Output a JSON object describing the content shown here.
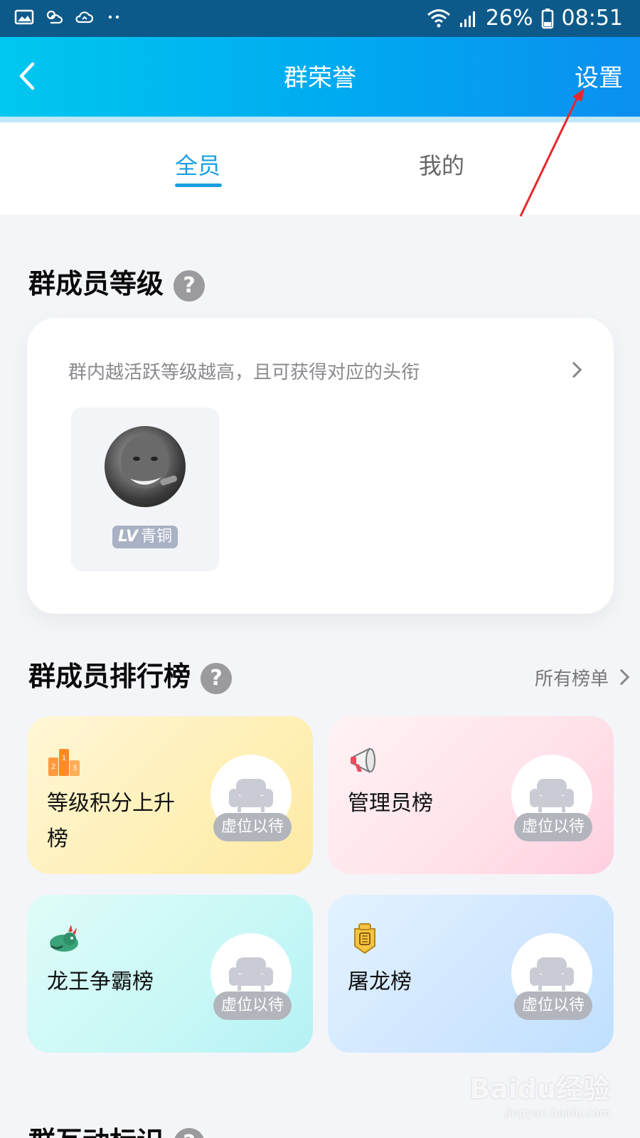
{
  "status_bar": {
    "battery": "26%",
    "time": "08:51"
  },
  "header": {
    "title": "群荣誉",
    "settings_label": "设置"
  },
  "tabs": [
    {
      "label": "全员",
      "active": true
    },
    {
      "label": "我的",
      "active": false
    }
  ],
  "level_section": {
    "title": "群成员等级",
    "help": "?",
    "description": "群内越活跃等级越高，且可获得对应的头衔",
    "member": {
      "level_prefix": "LV",
      "level_name": "青铜"
    }
  },
  "ranking_section": {
    "title": "群成员排行榜",
    "help": "?",
    "all_lists_label": "所有榜单",
    "boards": [
      {
        "name_line1": "等级积分上升",
        "name_line2": "榜",
        "placeholder": "虚位以待",
        "icon": "podium-icon"
      },
      {
        "name_line1": "管理员榜",
        "name_line2": "",
        "placeholder": "虚位以待",
        "icon": "megaphone-icon"
      },
      {
        "name_line1": "龙王争霸榜",
        "name_line2": "",
        "placeholder": "虚位以待",
        "icon": "dragon-icon"
      },
      {
        "name_line1": "屠龙榜",
        "name_line2": "",
        "placeholder": "虚位以待",
        "icon": "dragon-badge-icon"
      }
    ]
  },
  "interaction_section": {
    "title": "群互动标识",
    "help": "?"
  },
  "watermark": {
    "brand": "Baidu经验",
    "url": "jingyan.baidu.com"
  },
  "colors": {
    "nav_gradient_start": "#00c8ef",
    "nav_gradient_end": "#0b8ff0",
    "tab_active": "#1a9fe0",
    "annotation_arrow": "#e8262c"
  }
}
